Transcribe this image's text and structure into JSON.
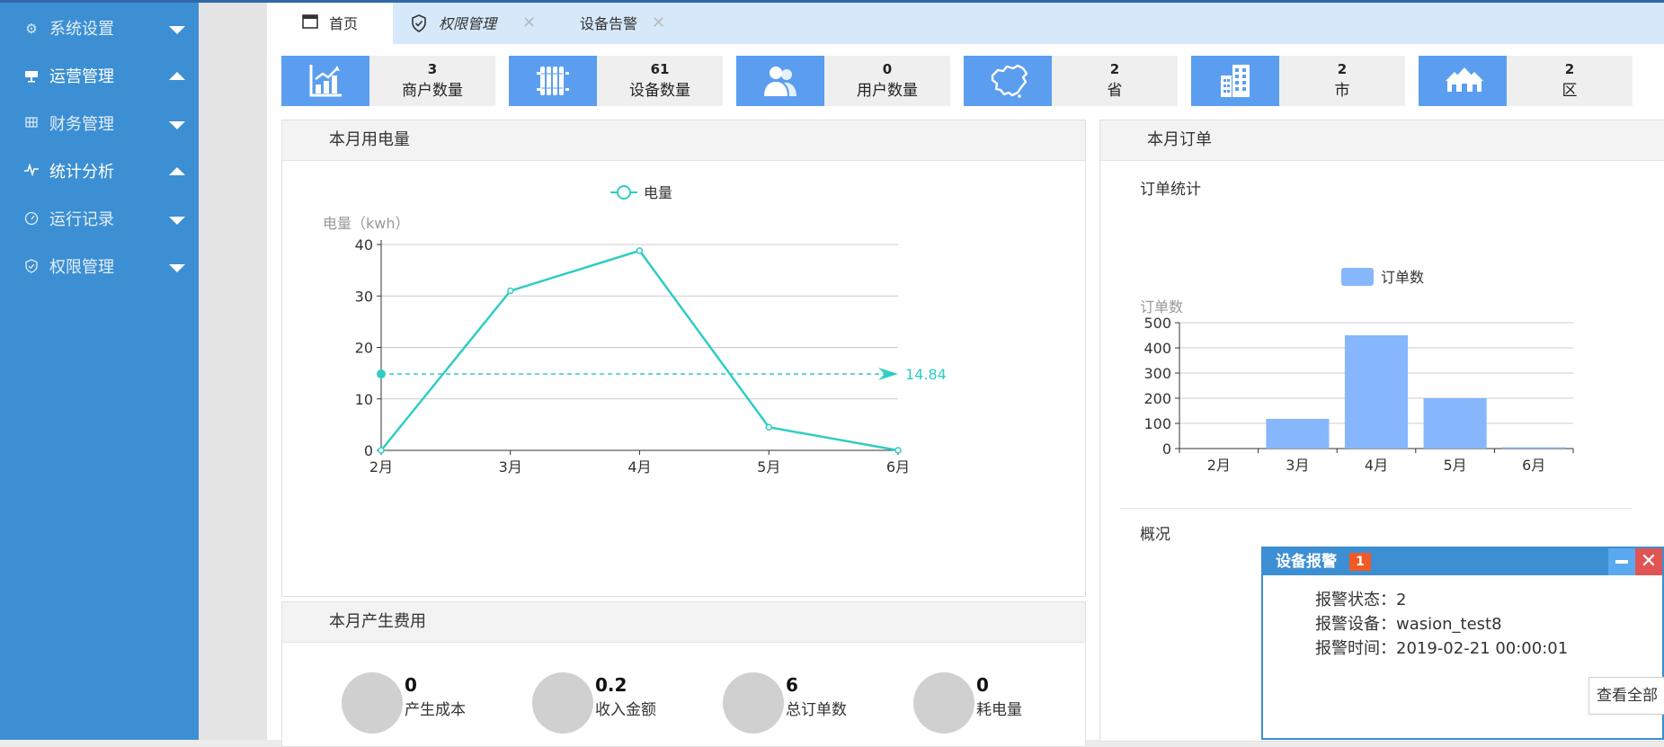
{
  "sidebar": {
    "items": [
      {
        "label": "系统设置",
        "icon": "gear-icon",
        "expanded": false
      },
      {
        "label": "运营管理",
        "icon": "billboard-icon",
        "expanded": true
      },
      {
        "label": "财务管理",
        "icon": "grid-icon",
        "expanded": false
      },
      {
        "label": "统计分析",
        "icon": "pulse-icon",
        "expanded": true
      },
      {
        "label": "运行记录",
        "icon": "speedometer-icon",
        "expanded": false
      },
      {
        "label": "权限管理",
        "icon": "shield-icon",
        "expanded": false
      }
    ]
  },
  "tabs": [
    {
      "label": "首页",
      "icon": "window-icon",
      "active": true
    },
    {
      "label": "权限管理",
      "icon": "shield-check-icon",
      "closable": true
    },
    {
      "label": "设备告警",
      "closable": true
    }
  ],
  "stats": [
    {
      "value": "3",
      "label": "商户数量",
      "icon": "bar-chart-icon"
    },
    {
      "value": "61",
      "label": "设备数量",
      "icon": "radiator-icon"
    },
    {
      "value": "0",
      "label": "用户数量",
      "icon": "users-icon"
    },
    {
      "value": "2",
      "label": "省",
      "icon": "china-map-icon"
    },
    {
      "value": "2",
      "label": "市",
      "icon": "building-icon"
    },
    {
      "value": "2",
      "label": "区",
      "icon": "houses-icon"
    }
  ],
  "panels": {
    "power_title": "本月用电量",
    "orders_title": "本月订单",
    "orders_subtitle": "订单统计",
    "overview_label": "概况",
    "fees_title": "本月产生费用"
  },
  "chart_data": [
    {
      "type": "line",
      "legend": [
        "电量"
      ],
      "ylabel": "电量（kwh）",
      "categories": [
        "2月",
        "3月",
        "4月",
        "5月",
        "6月"
      ],
      "series": [
        {
          "name": "电量",
          "values": [
            0,
            31,
            38.8,
            4.5,
            0
          ]
        }
      ],
      "ylim": [
        0,
        40
      ],
      "yticks": [
        0,
        10,
        20,
        30,
        40
      ],
      "mark_line": {
        "value": 14.84,
        "label": "14.84"
      },
      "color": "#2fcdc4",
      "grid": true
    },
    {
      "type": "bar",
      "legend": [
        "订单数"
      ],
      "ylabel": "订单数",
      "categories": [
        "2月",
        "3月",
        "4月",
        "5月",
        "6月"
      ],
      "series": [
        {
          "name": "订单数",
          "values": [
            0,
            118,
            450,
            200,
            5
          ]
        }
      ],
      "ylim": [
        0,
        500
      ],
      "yticks": [
        0,
        100,
        200,
        300,
        400,
        500
      ],
      "color": "#86b7fc",
      "grid": true
    }
  ],
  "fees": [
    {
      "value": "0",
      "label": "产生成本"
    },
    {
      "value": "0.2",
      "label": "收入金额"
    },
    {
      "value": "6",
      "label": "总订单数"
    },
    {
      "value": "0",
      "label": "耗电量"
    }
  ],
  "alarm": {
    "title": "设备报警",
    "badge": "1",
    "status_line": "报警状态：2",
    "device_line": "报警设备：wasion_test8",
    "time_line": "报警时间：2019-02-21 00:00:01",
    "view_all": "查看全部"
  },
  "colors": {
    "sidebar": "#3d8fd3",
    "accent": "#5b9ef0",
    "line": "#2fcdc4",
    "bar": "#86b7fc",
    "badge": "#f25a24"
  }
}
